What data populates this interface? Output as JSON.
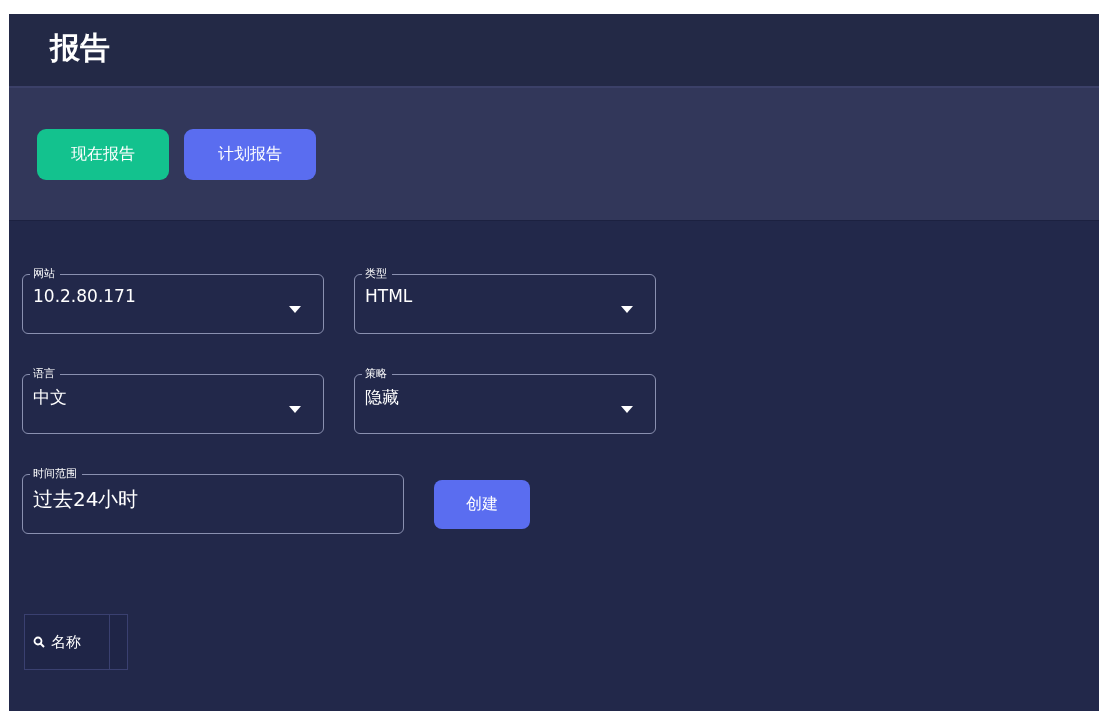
{
  "page": {
    "title": "报告"
  },
  "toolbar": {
    "buttons": [
      {
        "label": "现在报告",
        "kind": "primary"
      },
      {
        "label": "计划报告",
        "kind": "secondary"
      }
    ]
  },
  "form": {
    "rows": [
      [
        {
          "label": "网站",
          "value": "10.2.80.171",
          "kind": "select"
        },
        {
          "label": "类型",
          "value": "HTML",
          "kind": "select"
        }
      ],
      [
        {
          "label": "语言",
          "value": "中文",
          "kind": "select"
        },
        {
          "label": "策略",
          "value": "隐藏",
          "kind": "select"
        }
      ],
      [
        {
          "label": "时间范围",
          "value": "过去24小时",
          "kind": "text"
        }
      ]
    ],
    "submit": "创建"
  },
  "table": {
    "columns": [
      {
        "label": "名称",
        "searchable": true
      }
    ]
  }
}
